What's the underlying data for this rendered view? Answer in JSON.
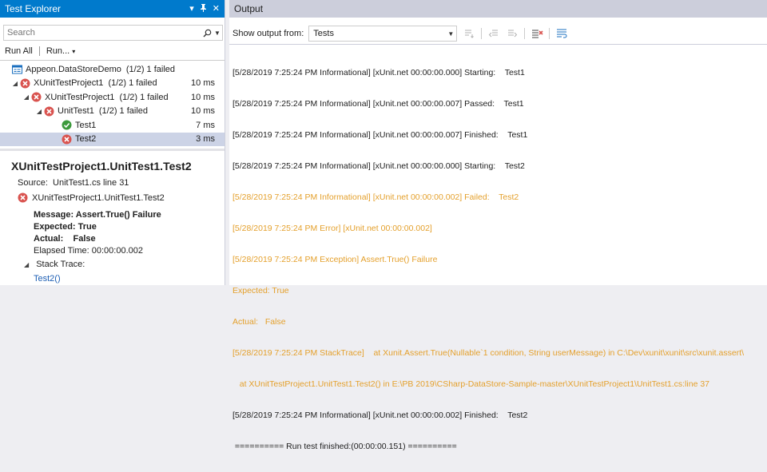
{
  "test_explorer": {
    "title": "Test Explorer",
    "title_icons": [
      "dropdown-arrow",
      "pin-icon",
      "close-icon"
    ],
    "search_placeholder": "Search",
    "toolbar": {
      "run_all": "Run All",
      "run": "Run..."
    },
    "tree": [
      {
        "name": "Appeon.DataStoreDemo",
        "summary": "(1/2) 1 failed",
        "duration": "",
        "status": "container",
        "indent": 0,
        "expanded": true,
        "selected": false
      },
      {
        "name": "XUnitTestProject1",
        "summary": "(1/2) 1 failed",
        "duration": "10 ms",
        "status": "failed",
        "indent": 1,
        "expanded": true,
        "selected": false
      },
      {
        "name": "XUnitTestProject1",
        "summary": "(1/2) 1 failed",
        "duration": "10 ms",
        "status": "failed",
        "indent": 2,
        "expanded": true,
        "selected": false
      },
      {
        "name": "UnitTest1",
        "summary": "(1/2) 1 failed",
        "duration": "10 ms",
        "status": "failed",
        "indent": 3,
        "expanded": true,
        "selected": false
      },
      {
        "name": "Test1",
        "summary": "",
        "duration": "7 ms",
        "status": "passed",
        "indent": 4,
        "expanded": false,
        "selected": false
      },
      {
        "name": "Test2",
        "summary": "",
        "duration": "3 ms",
        "status": "failed",
        "indent": 4,
        "expanded": false,
        "selected": true
      }
    ],
    "detail": {
      "title": "XUnitTestProject1.UnitTest1.Test2",
      "source_label": "Source:",
      "source_value": "UnitTest1.cs line 31",
      "failed_test": "XUnitTestProject1.UnitTest1.Test2",
      "message_label": "Message:",
      "message_value": "Assert.True() Failure",
      "expected_label": "Expected:",
      "expected_value": "True",
      "actual_label": "Actual:",
      "actual_value": "False",
      "elapsed_label": "Elapsed Time:",
      "elapsed_value": "00:00:00.002",
      "stack_trace_label": "Stack Trace:",
      "stack_link": "Test2()"
    }
  },
  "output": {
    "title": "Output",
    "show_output_from_label": "Show output from:",
    "source_selected": "Tests",
    "lines": [
      {
        "text": "[5/28/2019 7:25:24 PM Informational] [xUnit.net 00:00:00.000] Starting:    Test1",
        "kind": "normal"
      },
      {
        "text": "[5/28/2019 7:25:24 PM Informational] [xUnit.net 00:00:00.007] Passed:    Test1",
        "kind": "normal"
      },
      {
        "text": "[5/28/2019 7:25:24 PM Informational] [xUnit.net 00:00:00.007] Finished:    Test1",
        "kind": "normal"
      },
      {
        "text": "[5/28/2019 7:25:24 PM Informational] [xUnit.net 00:00:00.000] Starting:    Test2",
        "kind": "normal"
      },
      {
        "text": "[5/28/2019 7:25:24 PM Informational] [xUnit.net 00:00:00.002] Failed:    Test2",
        "kind": "error"
      },
      {
        "text": "[5/28/2019 7:25:24 PM Error] [xUnit.net 00:00:00.002]",
        "kind": "error"
      },
      {
        "text": "[5/28/2019 7:25:24 PM Exception] Assert.True() Failure",
        "kind": "error"
      },
      {
        "text": "Expected: True",
        "kind": "error"
      },
      {
        "text": "Actual:   False",
        "kind": "error"
      },
      {
        "text": "[5/28/2019 7:25:24 PM StackTrace]    at Xunit.Assert.True(Nullable`1 condition, String userMessage) in C:\\Dev\\xunit\\xunit\\src\\xunit.assert\\",
        "kind": "error"
      },
      {
        "text": "   at XUnitTestProject1.UnitTest1.Test2() in E:\\PB 2019\\CSharp-DataStore-Sample-master\\XUnitTestProject1\\UnitTest1.cs:line 37",
        "kind": "error"
      },
      {
        "text": "[5/28/2019 7:25:24 PM Informational] [xUnit.net 00:00:00.002] Finished:    Test2",
        "kind": "normal"
      },
      {
        "text": " ========== Run test finished:(00:00:00.151) ==========",
        "kind": "normal"
      }
    ],
    "colors": {
      "error_text": "#e4a02c",
      "title_bg": "#cccedb"
    }
  },
  "colors": {
    "accent": "#007acc",
    "failed": "#d9534f",
    "passed": "#3c9a3c",
    "selection": "#ccd3e6"
  }
}
